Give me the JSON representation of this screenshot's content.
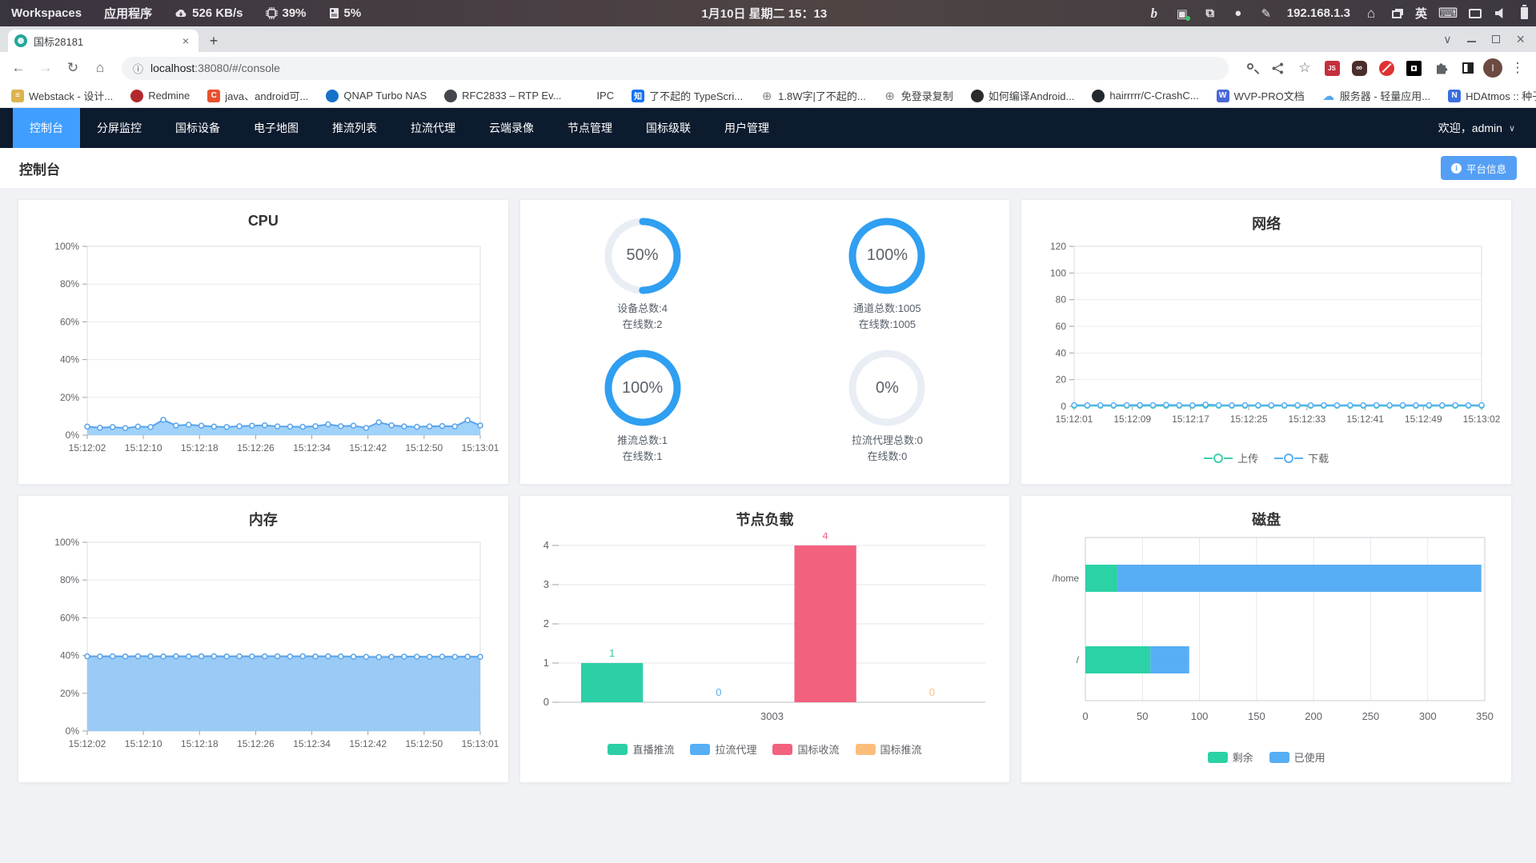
{
  "icons": {
    "back": "←",
    "forward": "→",
    "reload": "↻",
    "home": "⌂",
    "plus": "+",
    "close": "×",
    "chevron_down": "∨",
    "star": "☆",
    "menu": "⋮",
    "info": "ⓘ",
    "overflow": "»",
    "caret": "∨",
    "copy": "⧉",
    "dot": "●",
    "pen": "✎",
    "bing": "b",
    "screenshot": "▣",
    "keyboard": "⌨",
    "i_letter": "i"
  },
  "desktop": {
    "workspaces": "Workspaces",
    "apps_menu": "应用程序",
    "net_speed": "526 KB/s",
    "cpu_pct": "39%",
    "mem_pct": "5%",
    "clock": "1月10日 星期二 15：13",
    "ip": "192.168.1.3",
    "input_lang": "英"
  },
  "browser": {
    "tab_title": "国标28181",
    "url_host": "localhost",
    "url_rest": ":38080/#/console",
    "avatar_letter": "I",
    "ext_js": "JS",
    "ext_mask": "∞",
    "bookmarks": [
      {
        "label": "Webstack - 设计...",
        "icon": "letter",
        "letter": "≡",
        "color": "#dcb34e"
      },
      {
        "label": "Redmine",
        "icon": "circle",
        "color": "#b3282d"
      },
      {
        "label": "java、android可...",
        "icon": "letter",
        "letter": "C",
        "color": "#e8502e"
      },
      {
        "label": "QNAP Turbo NAS",
        "icon": "circle",
        "color": "#1770c9"
      },
      {
        "label": "RFC2833 – RTP Ev...",
        "icon": "circle",
        "color": "#43464d"
      },
      {
        "label": "IPC",
        "icon": "folder",
        "color": "#8d9094"
      },
      {
        "label": "了不起的 TypeScri...",
        "icon": "letter",
        "letter": "知",
        "color": "#1772f6"
      },
      {
        "label": "1.8W字|了不起的...",
        "icon": "globe",
        "color": "#80868b"
      },
      {
        "label": "免登录复制",
        "icon": "globe",
        "color": "#80868b"
      },
      {
        "label": "如何编译Android...",
        "icon": "circle",
        "color": "#2b2b2b"
      },
      {
        "label": "hairrrrr/C-CrashC...",
        "icon": "circle",
        "color": "#24292f"
      },
      {
        "label": "WVP-PRO文档",
        "icon": "letter",
        "letter": "W",
        "color": "#4a67d8"
      },
      {
        "label": "服务器 - 轻量应用...",
        "icon": "cloud",
        "color": "#58a6f0"
      },
      {
        "label": "HDAtmos :: 种子 *...",
        "icon": "letter",
        "letter": "N",
        "color": "#3b6fe0"
      }
    ]
  },
  "app": {
    "nav": [
      {
        "label": "控制台",
        "active": true
      },
      {
        "label": "分屏监控"
      },
      {
        "label": "国标设备"
      },
      {
        "label": "电子地图"
      },
      {
        "label": "推流列表"
      },
      {
        "label": "拉流代理"
      },
      {
        "label": "云端录像"
      },
      {
        "label": "节点管理"
      },
      {
        "label": "国标级联"
      },
      {
        "label": "用户管理"
      }
    ],
    "welcome": "欢迎，admin",
    "page_title": "控制台",
    "platform_info_button": "平台信息"
  },
  "chart_data": [
    {
      "id": "cpu",
      "type": "area",
      "title": "CPU",
      "ylim": [
        0,
        100
      ],
      "y_ticks": [
        "0%",
        "20%",
        "40%",
        "60%",
        "80%",
        "100%"
      ],
      "x_ticks": [
        "15:12:02",
        "15:12:10",
        "15:12:18",
        "15:12:26",
        "15:12:34",
        "15:12:42",
        "15:12:50",
        "15:13:01"
      ],
      "series": [
        {
          "name": "CPU",
          "color": "#58a4ec",
          "fill": "rgba(130,195,247,0.75)",
          "values": [
            4.5,
            3.9,
            4.3,
            3.7,
            4.5,
            4.3,
            8.1,
            5.1,
            5.5,
            5.0,
            4.5,
            4.3,
            4.7,
            5.0,
            5.2,
            4.6,
            4.5,
            4.4,
            4.7,
            5.7,
            4.7,
            5.0,
            3.8,
            6.8,
            5.2,
            4.6,
            4.4,
            4.6,
            4.8,
            4.6,
            7.9,
            5.1
          ]
        }
      ]
    },
    {
      "id": "stats",
      "type": "rings",
      "active_color": "#2f9ff2",
      "track_color": "#e9edf4",
      "rings": [
        {
          "percent": 50,
          "line1": "设备总数:4",
          "line2": "在线数:2"
        },
        {
          "percent": 100,
          "line1": "通道总数:1005",
          "line2": "在线数:1005"
        },
        {
          "percent": 100,
          "line1": "推流总数:1",
          "line2": "在线数:1"
        },
        {
          "percent": 0,
          "line1": "拉流代理总数:0",
          "line2": "在线数:0"
        }
      ]
    },
    {
      "id": "network",
      "type": "area",
      "title": "网络",
      "ylim": [
        0,
        120
      ],
      "y_ticks": [
        "0",
        "20",
        "40",
        "60",
        "80",
        "100",
        "120"
      ],
      "x_ticks": [
        "15:12:01",
        "15:12:09",
        "15:12:17",
        "15:12:25",
        "15:12:33",
        "15:12:41",
        "15:12:49",
        "15:13:02"
      ],
      "series": [
        {
          "name": "上传",
          "color": "#3ed0ac",
          "fill": null,
          "values": [
            0.4,
            0.4,
            0.4,
            0.4,
            0.4,
            0.4,
            0.4,
            0.4,
            0.4,
            0.4,
            0.4,
            0.4,
            0.4,
            0.4,
            0.4,
            0.4,
            0.4,
            0.4,
            0.4,
            0.4,
            0.4,
            0.4,
            0.4,
            0.4,
            0.4,
            0.4,
            0.4,
            0.4,
            0.4,
            0.4,
            0.4,
            0.4
          ]
        },
        {
          "name": "下载",
          "color": "#59b0f5",
          "fill": null,
          "values": [
            0.9,
            0.8,
            0.9,
            0.8,
            0.9,
            1.0,
            0.9,
            1.1,
            0.9,
            0.8,
            1.3,
            0.9,
            0.8,
            0.9,
            0.8,
            0.9,
            0.8,
            0.9,
            0.8,
            0.9,
            0.8,
            0.9,
            0.8,
            0.9,
            0.8,
            0.9,
            0.8,
            0.9,
            0.8,
            0.9,
            0.8,
            0.9
          ]
        }
      ]
    },
    {
      "id": "memory",
      "type": "area",
      "title": "内存",
      "ylim": [
        0,
        100
      ],
      "y_ticks": [
        "0%",
        "20%",
        "40%",
        "60%",
        "80%",
        "100%"
      ],
      "x_ticks": [
        "15:12:02",
        "15:12:10",
        "15:12:18",
        "15:12:26",
        "15:12:34",
        "15:12:42",
        "15:12:50",
        "15:13:01"
      ],
      "series": [
        {
          "name": "内存",
          "color": "#58a4ec",
          "fill": "rgba(125,188,244,0.78)",
          "values": [
            39.6,
            39.5,
            39.6,
            39.5,
            39.6,
            39.6,
            39.5,
            39.6,
            39.5,
            39.6,
            39.6,
            39.5,
            39.6,
            39.5,
            39.6,
            39.6,
            39.5,
            39.6,
            39.5,
            39.6,
            39.5,
            39.4,
            39.3,
            39.2,
            39.3,
            39.4,
            39.4,
            39.3,
            39.4,
            39.3,
            39.4,
            39.3
          ]
        }
      ]
    },
    {
      "id": "load",
      "type": "bar",
      "title": "节点负载",
      "ylim": [
        0,
        4
      ],
      "y_ticks": [
        "0",
        "1",
        "2",
        "3",
        "4"
      ],
      "category": "3003",
      "series": [
        {
          "name": "直播推流",
          "color": "#2dcfa6",
          "value": 1
        },
        {
          "name": "拉流代理",
          "color": "#57aef5",
          "value": 0
        },
        {
          "name": "国标收流",
          "color": "#f2617e",
          "value": 4
        },
        {
          "name": "国标推流",
          "color": "#fcbd7b",
          "value": 0
        }
      ]
    },
    {
      "id": "disk",
      "type": "hbar",
      "title": "磁盘",
      "xlim": [
        0,
        350
      ],
      "x_ticks": [
        0,
        50,
        100,
        150,
        200,
        250,
        300,
        350
      ],
      "categories": [
        "/home",
        "/"
      ],
      "series": [
        {
          "name": "剩余",
          "color": "#2bd2a5",
          "values": [
            28,
            57
          ]
        },
        {
          "name": "已使用",
          "color": "#57aef5",
          "values": [
            319,
            34
          ]
        }
      ]
    }
  ]
}
